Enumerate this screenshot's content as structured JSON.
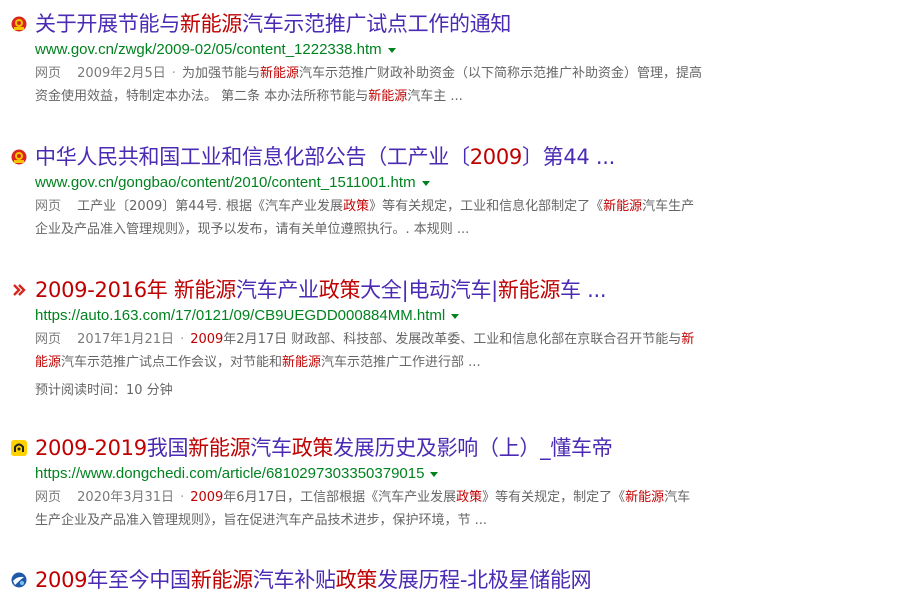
{
  "results": [
    {
      "icon": "gov-emblem-icon",
      "title_parts": [
        {
          "t": "关于开展节能与",
          "hl": false
        },
        {
          "t": "新能源",
          "hl": true
        },
        {
          "t": "汽车示范推广试点工作的通知",
          "hl": false
        }
      ],
      "url": "www.gov.cn/zwgk/2009-02/05/content_1222338.htm",
      "snippet_parts": [
        {
          "t": "网页",
          "c": "meta"
        },
        {
          "t": "2009年2月5日",
          "c": "meta",
          "dot": true
        },
        {
          "t": "为加强节能与",
          "c": "n"
        },
        {
          "t": "新能源",
          "c": "hl"
        },
        {
          "t": "汽车示范推广财政补助资金（以下简称示范推广补助资金）管理，提高资金使用效益，特制定本办法。 第二条 本办法所称节能与",
          "c": "n"
        },
        {
          "t": "新能源",
          "c": "hl"
        },
        {
          "t": "汽车主 ...",
          "c": "n"
        }
      ]
    },
    {
      "icon": "gov-emblem-icon",
      "title_parts": [
        {
          "t": "中华人民共和国工业和信息化部公告（工产业〔",
          "hl": false
        },
        {
          "t": "2009",
          "hl": true
        },
        {
          "t": "〕第44 ...",
          "hl": false
        }
      ],
      "url": "www.gov.cn/gongbao/content/2010/content_1511001.htm",
      "snippet_parts": [
        {
          "t": "网页",
          "c": "meta"
        },
        {
          "t": "工产业〔2009〕第44号. 根据《汽车产业发展",
          "c": "n"
        },
        {
          "t": "政策",
          "c": "hl"
        },
        {
          "t": "》等有关规定，工业和信息化部制定了《",
          "c": "n"
        },
        {
          "t": "新能源",
          "c": "hl"
        },
        {
          "t": "汽车生产企业及产品准入管理规则》，现予以发布，请有关单位遵照执行。. 本规则 ...",
          "c": "n"
        }
      ]
    },
    {
      "icon": "netease-icon",
      "title_parts": [
        {
          "t": "2009-2016年 ",
          "hl": true
        },
        {
          "t": "新能源",
          "hl": true
        },
        {
          "t": "汽车产业",
          "hl": false
        },
        {
          "t": "政策",
          "hl": true
        },
        {
          "t": "大全|电动汽车|",
          "hl": false
        },
        {
          "t": "新能源",
          "hl": true
        },
        {
          "t": "车 ...",
          "hl": false
        }
      ],
      "url": "https://auto.163.com/17/0121/09/CB9UEGDD000884MM.html",
      "snippet_parts": [
        {
          "t": "网页",
          "c": "meta"
        },
        {
          "t": "2017年1月21日",
          "c": "meta",
          "dot": true
        },
        {
          "t": "2009",
          "c": "hl"
        },
        {
          "t": "年2月17日 财政部、科技部、发展改革委、工业和信息化部在京联合召开节能与",
          "c": "n"
        },
        {
          "t": "新能源",
          "c": "hl"
        },
        {
          "t": "汽车示范推广试点工作会议，对节能和",
          "c": "n"
        },
        {
          "t": "新能源",
          "c": "hl"
        },
        {
          "t": "汽车示范推广工作进行部 ...",
          "c": "n"
        }
      ],
      "reading_time": "预计阅读时间：10 分钟"
    },
    {
      "icon": "dongchedi-icon",
      "title_parts": [
        {
          "t": "2009-2019",
          "hl": true
        },
        {
          "t": "我国",
          "hl": false
        },
        {
          "t": "新能源",
          "hl": true
        },
        {
          "t": "汽车",
          "hl": false
        },
        {
          "t": "政策",
          "hl": true
        },
        {
          "t": "发展历史及影响（上）_懂车帝",
          "hl": false
        }
      ],
      "url": "https://www.dongchedi.com/article/6810297303350379015",
      "snippet_parts": [
        {
          "t": "网页",
          "c": "meta"
        },
        {
          "t": "2020年3月31日",
          "c": "meta",
          "dot": true
        },
        {
          "t": "2009",
          "c": "hl"
        },
        {
          "t": "年6月17日，工信部根据《汽车产业发展",
          "c": "n"
        },
        {
          "t": "政策",
          "c": "hl"
        },
        {
          "t": "》等有关规定，制定了《",
          "c": "n"
        },
        {
          "t": "新能源",
          "c": "hl"
        },
        {
          "t": "汽车生产企业及产品准入管理规则》，旨在促进汽车产品技术进步，保护环境，节 ...",
          "c": "n"
        }
      ]
    },
    {
      "icon": "globe-icon",
      "title_parts": [
        {
          "t": "2009",
          "hl": true
        },
        {
          "t": "年至今中国",
          "hl": false
        },
        {
          "t": "新能源",
          "hl": true
        },
        {
          "t": "汽车补贴",
          "hl": false
        },
        {
          "t": "政策",
          "hl": true
        },
        {
          "t": "发展历程-北极星储能网",
          "hl": false
        }
      ]
    }
  ]
}
